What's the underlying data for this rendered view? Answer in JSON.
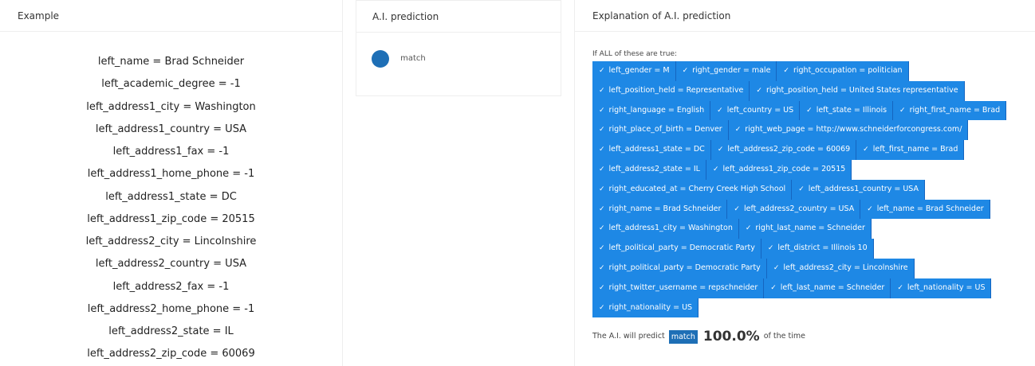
{
  "example": {
    "title": "Example",
    "lines": [
      "left_name = Brad Schneider",
      "left_academic_degree = -1",
      "left_address1_city = Washington",
      "left_address1_country = USA",
      "left_address1_fax = -1",
      "left_address1_home_phone = -1",
      "left_address1_state = DC",
      "left_address1_zip_code = 20515",
      "left_address2_city = Lincolnshire",
      "left_address2_country = USA",
      "left_address2_fax = -1",
      "left_address2_home_phone = -1",
      "left_address2_state = IL",
      "left_address2_zip_code = 60069"
    ]
  },
  "prediction": {
    "title": "A.I. prediction",
    "label": "match",
    "dot_color": "#1e6fb6"
  },
  "explanation": {
    "title": "Explanation of A.I. prediction",
    "conditions_title": "If ALL of these are true:",
    "check_icon": "✓",
    "tag_color": "#1e88e5",
    "rows": [
      [
        "left_gender = M",
        "right_gender = male",
        "right_occupation = politician"
      ],
      [
        "left_position_held = Representative",
        "right_position_held = United States representative"
      ],
      [
        "right_language = English",
        "left_country = US",
        "left_state = Illinois",
        "right_first_name = Brad"
      ],
      [
        "right_place_of_birth = Denver",
        "right_web_page = http://www.schneiderforcongress.com/"
      ],
      [
        "left_address1_state = DC",
        "left_address2_zip_code = 60069",
        "left_first_name = Brad"
      ],
      [
        "left_address2_state = IL",
        "left_address1_zip_code = 20515"
      ],
      [
        "right_educated_at = Cherry Creek High School",
        "left_address1_country = USA"
      ],
      [
        "right_name = Brad Schneider",
        "left_address2_country = USA",
        "left_name = Brad Schneider"
      ],
      [
        "left_address1_city = Washington",
        "right_last_name = Schneider"
      ],
      [
        "left_political_party = Democratic Party",
        "left_district = Illinois 10"
      ],
      [
        "right_political_party = Democratic Party",
        "left_address2_city = Lincolnshire"
      ],
      [
        "right_twitter_username = repschneider",
        "left_last_name = Schneider",
        "left_nationality = US"
      ],
      [
        "right_nationality = US"
      ]
    ],
    "summary": {
      "prefix": "The A.I. will predict",
      "badge": "match",
      "percent": "100.0%",
      "suffix": "of the time"
    }
  }
}
